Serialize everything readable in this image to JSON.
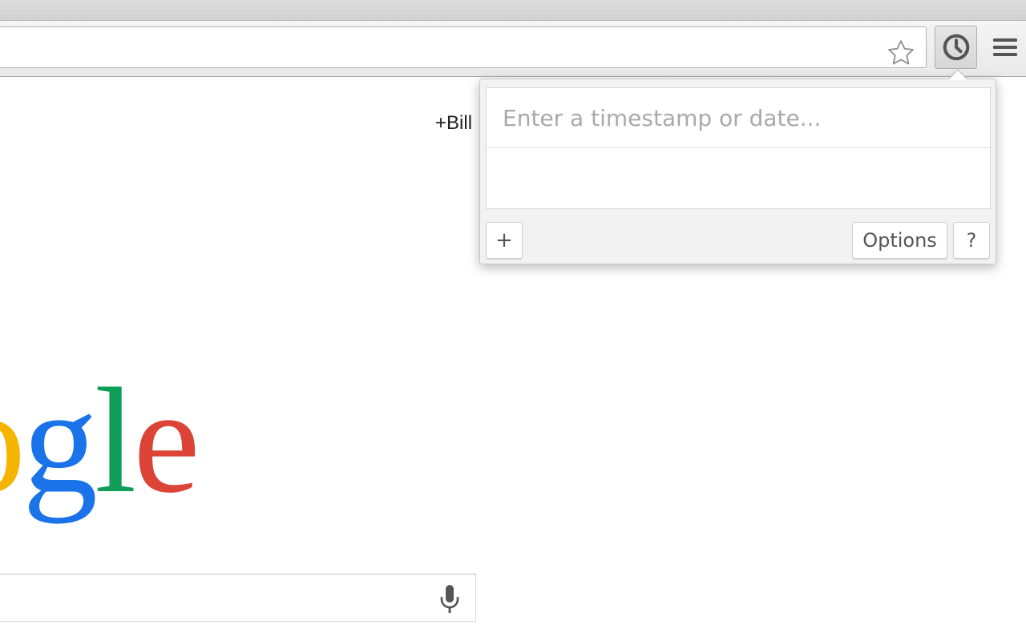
{
  "browser": {
    "omnibox": {
      "value": "",
      "placeholder": ""
    },
    "icons": {
      "bookmark": "star-outline",
      "extension": "clock",
      "menu": "hamburger"
    }
  },
  "page": {
    "user_link": "+Bill",
    "logo_letters": [
      {
        "char": "o",
        "color": "#f4b400"
      },
      {
        "char": "g",
        "color": "#1a73e8"
      },
      {
        "char": "l",
        "color": "#0f9d58"
      },
      {
        "char": "e",
        "color": "#db4437"
      }
    ],
    "search": {
      "value": "",
      "icon": "microphone"
    }
  },
  "popup": {
    "input": {
      "value": "",
      "placeholder": "Enter a timestamp or date..."
    },
    "add_label": "+",
    "options_label": "Options",
    "help_label": "?"
  },
  "colors": {
    "accent_blue": "#1a73e8",
    "yellow": "#f4b400",
    "green": "#0f9d58",
    "red": "#db4437",
    "icon_gray": "#555555"
  }
}
